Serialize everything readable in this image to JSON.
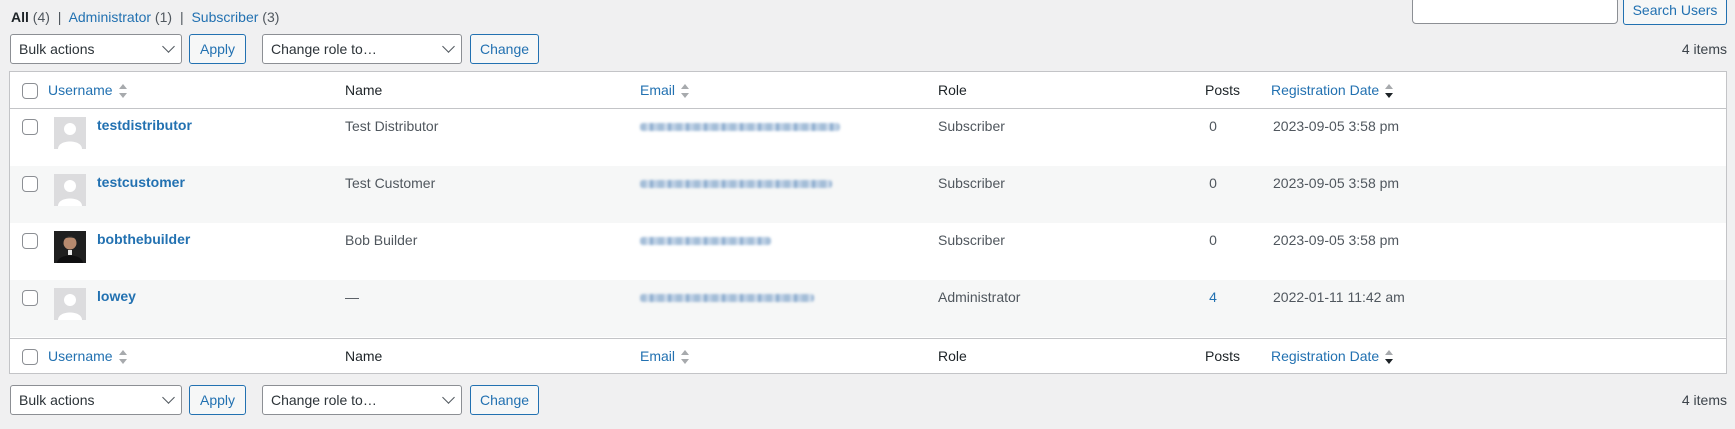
{
  "filters": {
    "all_label": "All",
    "all_count": "(4)",
    "admin_label": "Administrator",
    "admin_count": "(1)",
    "subscriber_label": "Subscriber",
    "subscriber_count": "(3)",
    "separator": "|"
  },
  "search": {
    "button_label": "Search Users",
    "value": ""
  },
  "tablenav": {
    "bulk_actions": "Bulk actions",
    "apply_label": "Apply",
    "change_role": "Change role to…",
    "change_label": "Change",
    "items_count": "4 items"
  },
  "columns": {
    "username": "Username",
    "name": "Name",
    "email": "Email",
    "role": "Role",
    "posts": "Posts",
    "registration_date": "Registration Date"
  },
  "users": [
    {
      "username": "testdistributor",
      "name": "Test Distributor",
      "role": "Subscriber",
      "posts": "0",
      "registered": "2023-09-05 3:58 pm",
      "avatar": "default-avatar-icon"
    },
    {
      "username": "testcustomer",
      "name": "Test Customer",
      "role": "Subscriber",
      "posts": "0",
      "registered": "2023-09-05 3:58 pm",
      "avatar": "default-avatar-icon"
    },
    {
      "username": "bobthebuilder",
      "name": "Bob Builder",
      "role": "Subscriber",
      "posts": "0",
      "registered": "2023-09-05 3:58 pm",
      "avatar": "photo-avatar"
    },
    {
      "username": "lowey",
      "name": "—",
      "role": "Administrator",
      "posts": "4",
      "registered": "2022-01-11 11:42 am",
      "avatar": "default-avatar-icon"
    }
  ],
  "colors": {
    "link": "#2271b1",
    "background": "#f0f0f1",
    "alt_row": "#f6f7f7",
    "border": "#c3c4c7"
  }
}
